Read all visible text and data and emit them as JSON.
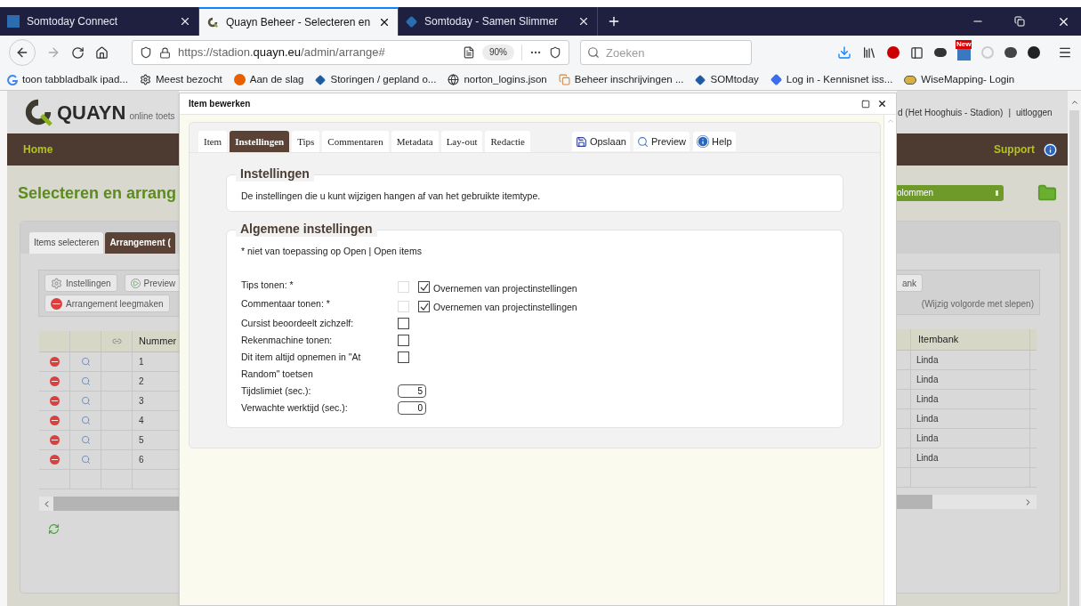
{
  "browser": {
    "tabs": [
      {
        "title": "Somtoday Connect",
        "selected": false
      },
      {
        "title": "Quayn Beheer - Selecteren en",
        "selected": true
      },
      {
        "title": "Somtoday - Samen Slimmer",
        "selected": false
      }
    ],
    "url": "https://stadion.**quayn.eu**/admin/arrange#",
    "zoom": "90%",
    "search": {
      "placeholder": "Zoeken"
    },
    "new_badge": "New",
    "bookmarks": [
      "toon tabbladbalk ipad...",
      "Meest bezocht",
      "Aan de slag",
      "Storingen / gepland o...",
      "norton_logins.json",
      "Beheer inschrijvingen ...",
      "SOMtoday",
      "Log in - Kennisnet iss...",
      "WiseMapping- Login"
    ]
  },
  "page": {
    "logo": {
      "name": "QUAYN",
      "tagline": "online toets"
    },
    "user": "d (Het Hooghuis - Stadion)",
    "separator": "|",
    "logout": "uitloggen",
    "nav": {
      "home": "Home",
      "support": "Support"
    },
    "heading": "Selecteren en arrang",
    "column_select": "olommen",
    "tabs": [
      {
        "label": "Items selecteren",
        "selected": false
      },
      {
        "label": "Arrangement (",
        "selected": true
      }
    ],
    "toolbar": [
      {
        "label": "Instellingen",
        "kind": "settings"
      },
      {
        "label": "Preview",
        "kind": "preview"
      },
      {
        "label": "Arrangement leegmaken",
        "kind": "clear"
      }
    ],
    "right_button": "ank",
    "hint": "(Wijzig volgorde met slepen)",
    "table": {
      "columns": [
        "Nummer",
        "Itembank"
      ],
      "rows": [
        [
          "1",
          "Linda"
        ],
        [
          "2",
          "Linda"
        ],
        [
          "3",
          "Linda"
        ],
        [
          "4",
          "Linda"
        ],
        [
          "5",
          "Linda"
        ],
        [
          "6",
          "Linda"
        ]
      ]
    }
  },
  "dialog": {
    "title": "Item bewerken",
    "tabs": [
      {
        "label": "Item",
        "selected": false
      },
      {
        "label": "Instellingen",
        "selected": true
      },
      {
        "label": "Tips",
        "selected": false
      },
      {
        "label": "Commentaren",
        "selected": false
      },
      {
        "label": "Metadata",
        "selected": false
      },
      {
        "label": "Lay-out",
        "selected": false
      },
      {
        "label": "Redactie",
        "selected": false
      }
    ],
    "actions": [
      {
        "label": "Opslaan",
        "kind": "save"
      },
      {
        "label": "Preview",
        "kind": "preview"
      },
      {
        "label": "Help",
        "kind": "help"
      }
    ],
    "sections": [
      {
        "title": "Instellingen",
        "text": "De instellingen die u kunt wijzigen hangen af van het gebruikte itemtype."
      },
      {
        "title": "Algemene instellingen",
        "text": "* niet van toepassing op Open | Open items",
        "settings": [
          {
            "kind": "checkbox",
            "label": "Tips tonen: *",
            "checked": false,
            "disabled": true,
            "inherit": {
              "label": "Overnemen van projectinstellingen",
              "checked": true
            }
          },
          {
            "kind": "checkbox",
            "label": "Commentaar tonen: *",
            "checked": false,
            "disabled": true,
            "inherit": {
              "label": "Overnemen van projectinstellingen",
              "checked": true
            }
          },
          {
            "kind": "checkbox",
            "label": "Cursist beoordeelt zichzelf:",
            "checked": false,
            "disabled": false
          },
          {
            "kind": "checkbox",
            "label": "Rekenmachine tonen:",
            "checked": false,
            "disabled": false
          },
          {
            "kind": "checkbox",
            "label": "Dit item altijd opnemen in \"At Random\" toetsen",
            "checked": false,
            "disabled": false
          },
          {
            "kind": "number",
            "label": "Tijdslimiet (sec.):",
            "value": "5"
          },
          {
            "kind": "number",
            "label": "Verwachte werktijd (sec.):",
            "value": "0"
          }
        ]
      }
    ]
  }
}
